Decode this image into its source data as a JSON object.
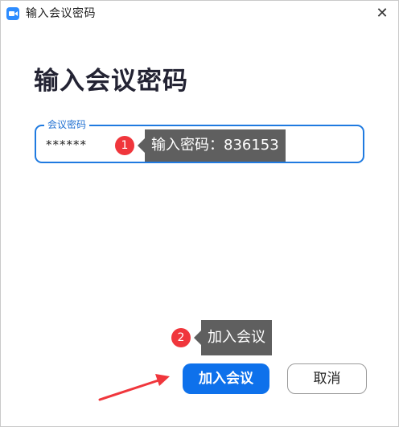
{
  "window": {
    "title": "输入会议密码",
    "close_glyph": "✕",
    "icon": "zoom-camera-icon"
  },
  "main": {
    "heading": "输入会议密码",
    "password_field": {
      "label": "会议密码",
      "value": "******"
    }
  },
  "annotations": {
    "step1": {
      "number": "1",
      "text": "输入密码：836153"
    },
    "step2": {
      "number": "2",
      "text": "加入会议"
    },
    "arrow_color": "#f0363c"
  },
  "buttons": {
    "join_label": "加入会议",
    "cancel_label": "取消"
  },
  "colors": {
    "accent": "#0e71eb",
    "field_border": "#1f7ae0",
    "badge": "#f0363c",
    "tooltip_bg": "#5f5f5f"
  }
}
